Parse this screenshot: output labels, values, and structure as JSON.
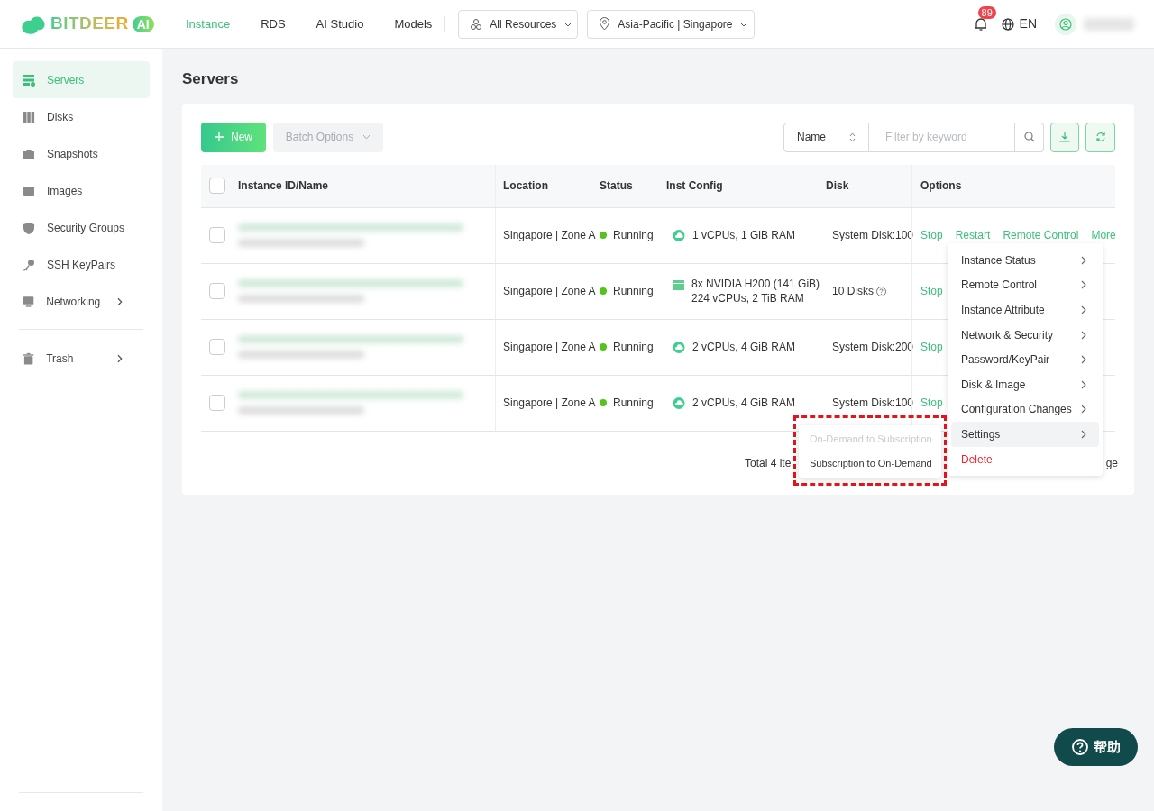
{
  "header": {
    "logo": {
      "word": "BITDEER",
      "badge": "AI"
    },
    "nav": [
      {
        "label": "Instance",
        "selected": true
      },
      {
        "label": "RDS",
        "selected": false
      },
      {
        "label": "AI Studio",
        "selected": false
      },
      {
        "label": "Models",
        "selected": false
      }
    ],
    "resource_select": "All Resources",
    "region_select": "Asia-Pacific | Singapore",
    "notifications": "89",
    "language": "EN"
  },
  "sidebar": {
    "groups": [
      [
        {
          "label": "Servers",
          "selected": true,
          "expandable": false
        },
        {
          "label": "Disks",
          "selected": false,
          "expandable": false
        },
        {
          "label": "Snapshots",
          "selected": false,
          "expandable": false
        },
        {
          "label": "Images",
          "selected": false,
          "expandable": false
        },
        {
          "label": "Security Groups",
          "selected": false,
          "expandable": false
        },
        {
          "label": "SSH KeyPairs",
          "selected": false,
          "expandable": false
        },
        {
          "label": "Networking",
          "selected": false,
          "expandable": true
        }
      ],
      [
        {
          "label": "Trash",
          "selected": false,
          "expandable": true
        }
      ]
    ]
  },
  "page_title": "Servers",
  "toolbar": {
    "new_button": "New",
    "batch_button": "Batch Options",
    "filter_select": "Name",
    "search": {
      "placeholder": "Filter by keyword"
    }
  },
  "table": {
    "all_checked": false,
    "columns": [
      "Instance ID/Name",
      "Location",
      "Status",
      "Inst Config",
      "Disk",
      "Options"
    ],
    "rows": [
      {
        "checked": false,
        "location": "Singapore | Zone A",
        "status": "Running",
        "kind": "cloud",
        "config": [
          "1 vCPUs, 1 GiB RAM"
        ],
        "disk": "System Disk:100",
        "disk_hint": false,
        "actions": [
          "Stop",
          "Restart",
          "Remote Control",
          "More"
        ]
      },
      {
        "checked": false,
        "location": "Singapore | Zone A",
        "status": "Running",
        "kind": "gpu",
        "config": [
          "8x NVIDIA H200 (141 GiB)",
          "224 vCPUs, 2 TiB RAM"
        ],
        "disk": "10 Disks",
        "disk_hint": true,
        "actions": [
          "Stop"
        ]
      },
      {
        "checked": false,
        "location": "Singapore | Zone A",
        "status": "Running",
        "kind": "cloud",
        "config": [
          "2 vCPUs, 4 GiB RAM"
        ],
        "disk": "System Disk:200",
        "disk_hint": false,
        "actions": [
          "Stop"
        ]
      },
      {
        "checked": false,
        "location": "Singapore | Zone A",
        "status": "Running",
        "kind": "cloud",
        "config": [
          "2 vCPUs, 4 GiB RAM"
        ],
        "disk": "System Disk:100",
        "disk_hint": false,
        "actions": [
          "Stop"
        ]
      }
    ]
  },
  "pagination": {
    "total": "Total 4 ite",
    "tail": "ge"
  },
  "more_menu": [
    {
      "label": "Instance Status",
      "kind": "submenu",
      "selected": false
    },
    {
      "label": "Remote Control",
      "kind": "submenu",
      "selected": false
    },
    {
      "label": "Instance Attribute",
      "kind": "submenu",
      "selected": false
    },
    {
      "label": "Network & Security",
      "kind": "submenu",
      "selected": false
    },
    {
      "label": "Password/KeyPair",
      "kind": "submenu",
      "selected": false
    },
    {
      "label": "Disk & Image",
      "kind": "submenu",
      "selected": false
    },
    {
      "label": "Configuration Changes",
      "kind": "submenu",
      "selected": false
    },
    {
      "label": "Settings",
      "kind": "submenu",
      "selected": true
    },
    {
      "label": "Delete",
      "kind": "danger",
      "selected": false
    }
  ],
  "settings_submenu": [
    {
      "label": "On-Demand to Subscription",
      "disabled": true
    },
    {
      "label": "Subscription to On-Demand",
      "disabled": false
    }
  ],
  "help_button": "帮助"
}
